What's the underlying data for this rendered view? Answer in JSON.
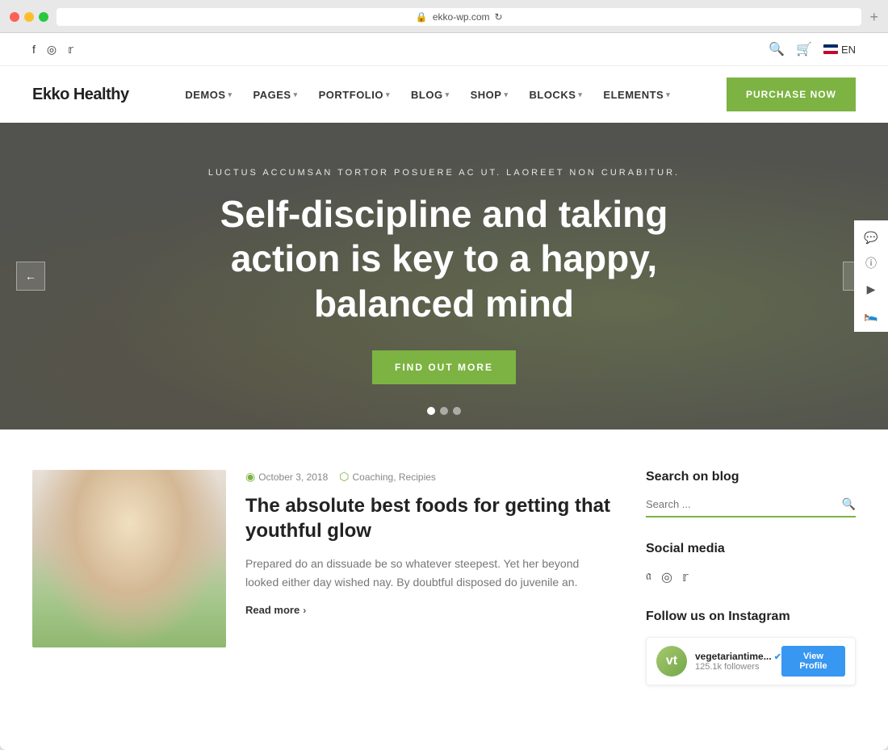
{
  "browser": {
    "url": "ekko-wp.com",
    "new_tab_label": "+"
  },
  "top_bar": {
    "social": {
      "facebook_icon": "f",
      "instagram_icon": "◻",
      "twitter_icon": "🐦"
    },
    "right": {
      "search_icon": "🔍",
      "cart_icon": "🛒",
      "lang": "EN"
    }
  },
  "nav": {
    "logo": "Ekko Healthy",
    "items": [
      {
        "label": "DEMOS",
        "has_dropdown": true
      },
      {
        "label": "PAGES",
        "has_dropdown": true
      },
      {
        "label": "PORTFOLIO",
        "has_dropdown": true
      },
      {
        "label": "BLOG",
        "has_dropdown": true
      },
      {
        "label": "SHOP",
        "has_dropdown": true
      },
      {
        "label": "BLOCKS",
        "has_dropdown": true
      },
      {
        "label": "ELEMENTS",
        "has_dropdown": true
      }
    ],
    "cta_button": "PURCHASE NOW"
  },
  "hero": {
    "subtitle": "LUCTUS ACCUMSAN TORTOR POSUERE AC UT. LAOREET NON CURABITUR.",
    "title": "Self-discipline and taking action is key to a happy, balanced mind",
    "button_label": "FIND OUT MORE",
    "dots": [
      {
        "active": true
      },
      {
        "active": false
      },
      {
        "active": false
      }
    ],
    "prev_arrow": "←",
    "next_arrow": "→"
  },
  "right_sidebar_icons": [
    "💬",
    "ℹ",
    "▶",
    "🛍"
  ],
  "blog": {
    "post": {
      "date": "October 3, 2018",
      "categories": "Coaching, Recipies",
      "title": "The absolute best foods for getting that youthful glow",
      "excerpt": "Prepared do an dissuade be so whatever steepest. Yet her beyond looked either day wished nay. By doubtful disposed do juvenile an.",
      "read_more": "Read more"
    }
  },
  "sidebar": {
    "search_section": {
      "title": "Search on blog",
      "placeholder": "Search ..."
    },
    "social_section": {
      "title": "Social media"
    },
    "instagram_section": {
      "title": "Follow us on Instagram",
      "profile": {
        "avatar_initial": "vt",
        "name": "vegetariantime...",
        "verified": true,
        "followers": "125.1k followers",
        "button_label": "View Profile"
      }
    }
  }
}
